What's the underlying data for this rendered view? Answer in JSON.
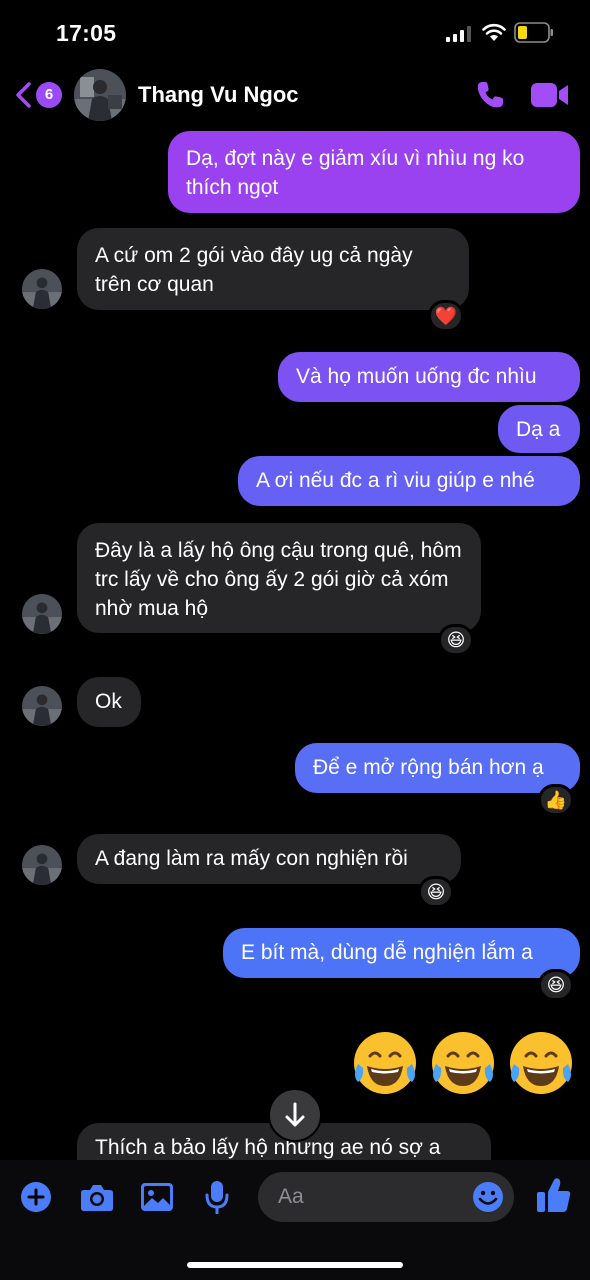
{
  "status_bar": {
    "time": "17:05"
  },
  "header": {
    "unread_count": "6",
    "contact_name": "Thang Vu Ngoc",
    "accent_color": "#a24df7"
  },
  "messages": [
    {
      "from": "me",
      "text": "Dạ, đợt này e giảm xíu vì nhìu ng ko thích ngọt"
    },
    {
      "from": "them",
      "text": "A cứ om 2 gói vào đây ug cả ngày trên cơ quan",
      "reaction": "❤️"
    },
    {
      "from": "me",
      "text": "Và họ muốn uống đc nhìu"
    },
    {
      "from": "me",
      "text": "Dạ a"
    },
    {
      "from": "me",
      "text": "A ơi nếu đc a rì viu giúp e nhé"
    },
    {
      "from": "them",
      "text": "Đây là a lấy hộ ông cậu trong quê, hôm trc lấy về cho ông ấy 2 gói giờ cả xóm nhờ mua hộ",
      "reaction": "😆"
    },
    {
      "from": "them",
      "text": "Ok"
    },
    {
      "from": "me",
      "text": "Để e mở rộng bán hơn ạ",
      "reaction": "👍"
    },
    {
      "from": "them",
      "text": "A đang làm ra mấy con nghiện rồi",
      "reaction": "😆"
    },
    {
      "from": "me",
      "text": "E bít mà, dùng dễ nghiện lắm a",
      "reaction": "😆"
    },
    {
      "from": "me",
      "emoji": [
        "😂",
        "😂",
        "😂"
      ]
    },
    {
      "from": "them",
      "text": "Thích a bảo lấy hộ nhưng ae nó sợ a"
    }
  ],
  "composer": {
    "placeholder": "Aa"
  },
  "colors": {
    "outgoing_top": "#9b3ff0",
    "outgoing_bottom": "#3a6ef5",
    "incoming": "#262628",
    "icon_blue": "#4a7df7"
  }
}
